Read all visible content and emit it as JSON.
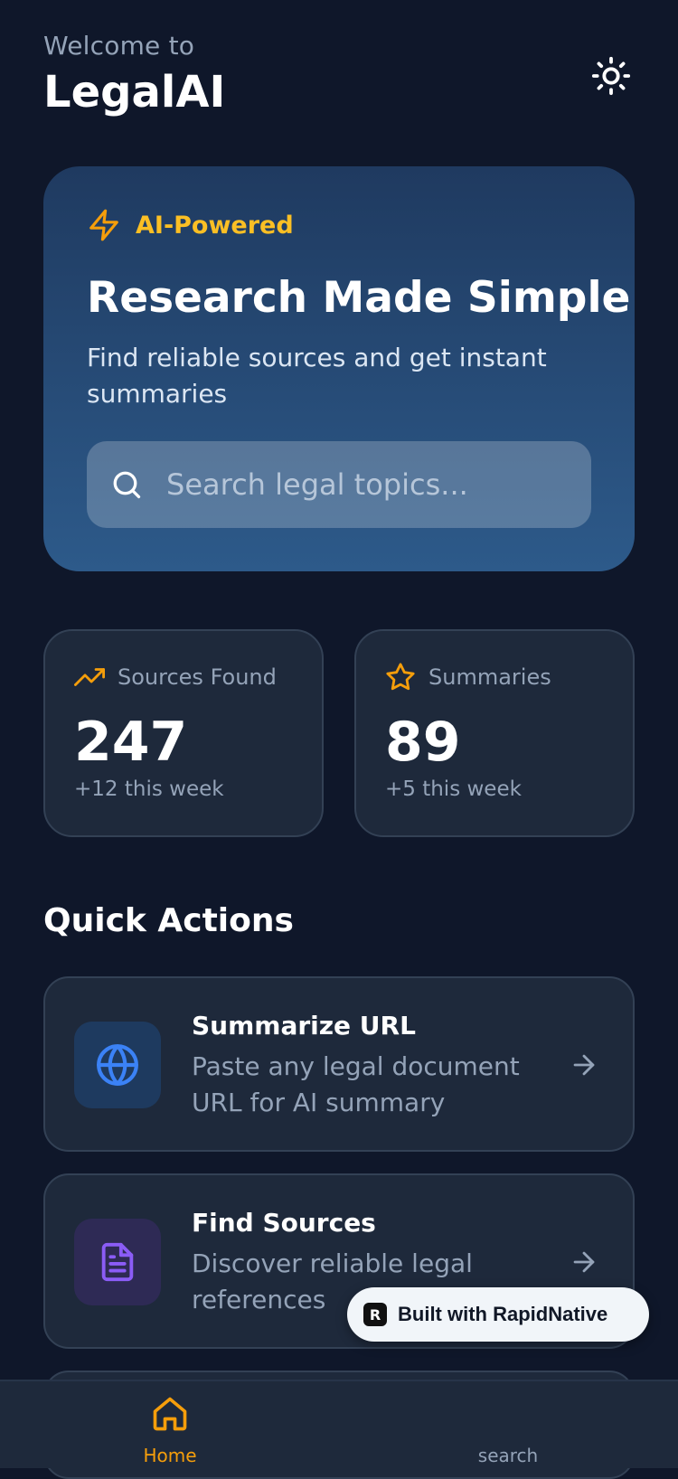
{
  "header": {
    "welcome": "Welcome to",
    "title": "LegalAI",
    "theme_icon": "sun-icon"
  },
  "hero": {
    "badge_label": "AI-Powered",
    "badge_icon": "lightning-icon",
    "title": "Research Made Simple",
    "subtitle": "Find reliable sources and get instant summaries",
    "search_placeholder": "Search legal topics...",
    "search_icon": "search-icon"
  },
  "stats": [
    {
      "label": "Sources Found",
      "value": "247",
      "delta": "+12 this week",
      "icon": "trending-up-icon",
      "color": "#f59e0b"
    },
    {
      "label": "Summaries",
      "value": "89",
      "delta": "+5 this week",
      "icon": "star-icon",
      "color": "#f59e0b"
    }
  ],
  "quick_actions": {
    "title": "Quick Actions",
    "items": [
      {
        "title": "Summarize URL",
        "desc": "Paste any legal document URL for AI summary",
        "icon": "globe-icon",
        "color": "#3b82f6"
      },
      {
        "title": "Find Sources",
        "desc": "Discover reliable legal references",
        "icon": "document-icon",
        "color": "#8b5cf6"
      }
    ]
  },
  "badge": {
    "label": "Built with RapidNative",
    "logo": "R"
  },
  "bottom_nav": [
    {
      "label": "Home",
      "icon": "home-icon",
      "active": true
    },
    {
      "label": "search",
      "icon": "search-icon",
      "active": false
    }
  ],
  "colors": {
    "background": "#0f172a",
    "card": "#1e293b",
    "accent": "#f59e0b",
    "hero_top": "#1f3a60",
    "hero_bottom": "#2d5a8a"
  }
}
